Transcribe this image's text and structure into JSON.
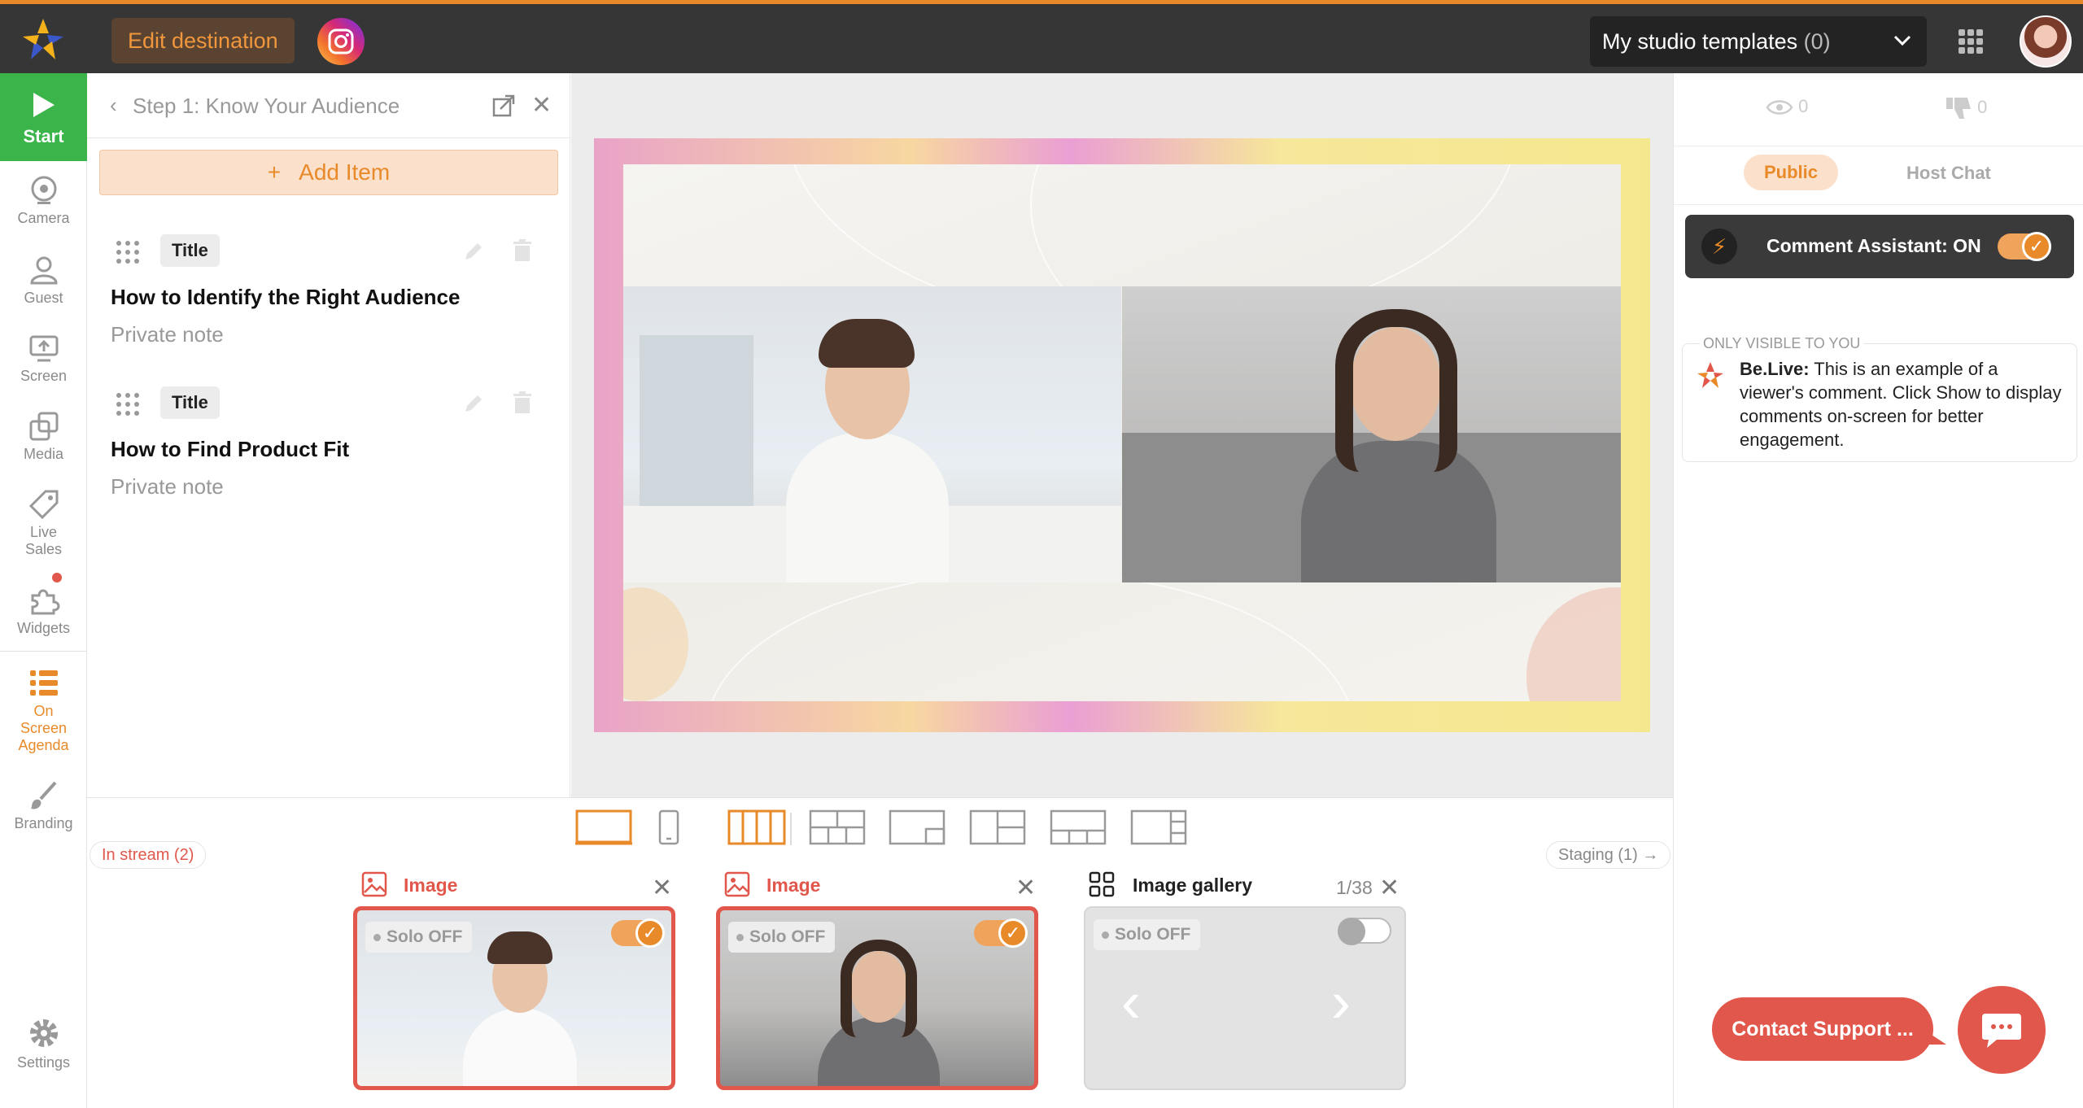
{
  "topbar": {
    "edit_destination": "Edit destination",
    "templates_label": "My studio templates",
    "templates_count": "(0)"
  },
  "rail": {
    "start": "Start",
    "camera": "Camera",
    "guest": "Guest",
    "screen": "Screen",
    "media": "Media",
    "live_sales_1": "Live",
    "live_sales_2": "Sales",
    "widgets": "Widgets",
    "agenda_1": "On",
    "agenda_2": "Screen",
    "agenda_3": "Agenda",
    "branding": "Branding",
    "settings": "Settings"
  },
  "agenda": {
    "title": "Step 1: Know Your Audience",
    "add_item": "Add Item",
    "items": [
      {
        "tag": "Title",
        "text": "How to Identify the Right Audience",
        "note": "Private note"
      },
      {
        "tag": "Title",
        "text": "How to Find Product Fit",
        "note": "Private note"
      }
    ]
  },
  "bottom": {
    "in_stream": "In stream (2)",
    "staging": "Staging (1) →",
    "thumbs": [
      {
        "label": "Image",
        "solo": "Solo OFF",
        "color": "#e2574c"
      },
      {
        "label": "Image",
        "solo": "Solo OFF",
        "color": "#e2574c"
      },
      {
        "label": "Image gallery",
        "solo": "Solo OFF",
        "counter": "1/38",
        "color": "#222222"
      }
    ]
  },
  "right": {
    "views": "0",
    "dislikes": "0",
    "tab_public": "Public",
    "tab_host": "Host Chat",
    "assistant": "Comment Assistant: ON",
    "only_visible": "ONLY VISIBLE TO YOU",
    "comment_author": "Be.Live:",
    "comment_text": " This is an example of a viewer's comment. Click Show to display comments on-screen for better engagement.",
    "support": "Contact Support ..."
  },
  "colors": {
    "accent": "#e98a2a",
    "start_green": "#3bb54a",
    "alert_red": "#e2574c"
  }
}
